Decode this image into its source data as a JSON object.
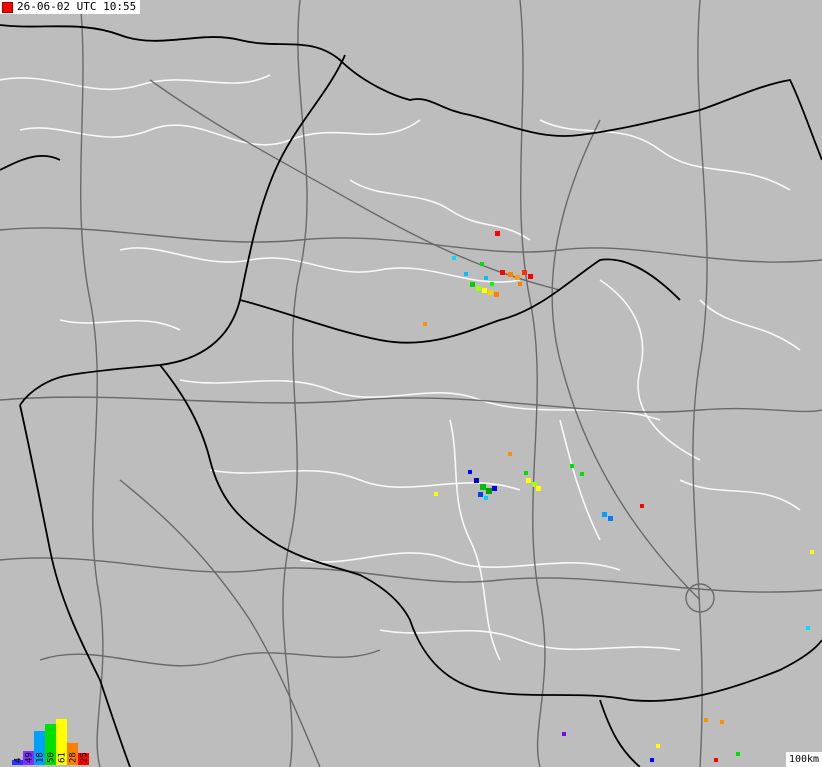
{
  "timestamp": "26-06-02 UTC 10:55",
  "scale": "100km",
  "legend": {
    "labels": [
      "4",
      "49",
      "18",
      "50",
      "61",
      "28",
      "25"
    ],
    "levels": [
      0.1,
      0.3,
      0.7,
      0.85,
      0.95,
      0.45,
      0.25
    ],
    "colors": [
      "#3030ff",
      "#8030ff",
      "#00a0ff",
      "#00e000",
      "#ffff00",
      "#ff8000",
      "#ff0000"
    ]
  },
  "colors": {
    "land": "#bdbdbd",
    "border": "#000000",
    "road": "#555555",
    "river": "#ffffff"
  }
}
